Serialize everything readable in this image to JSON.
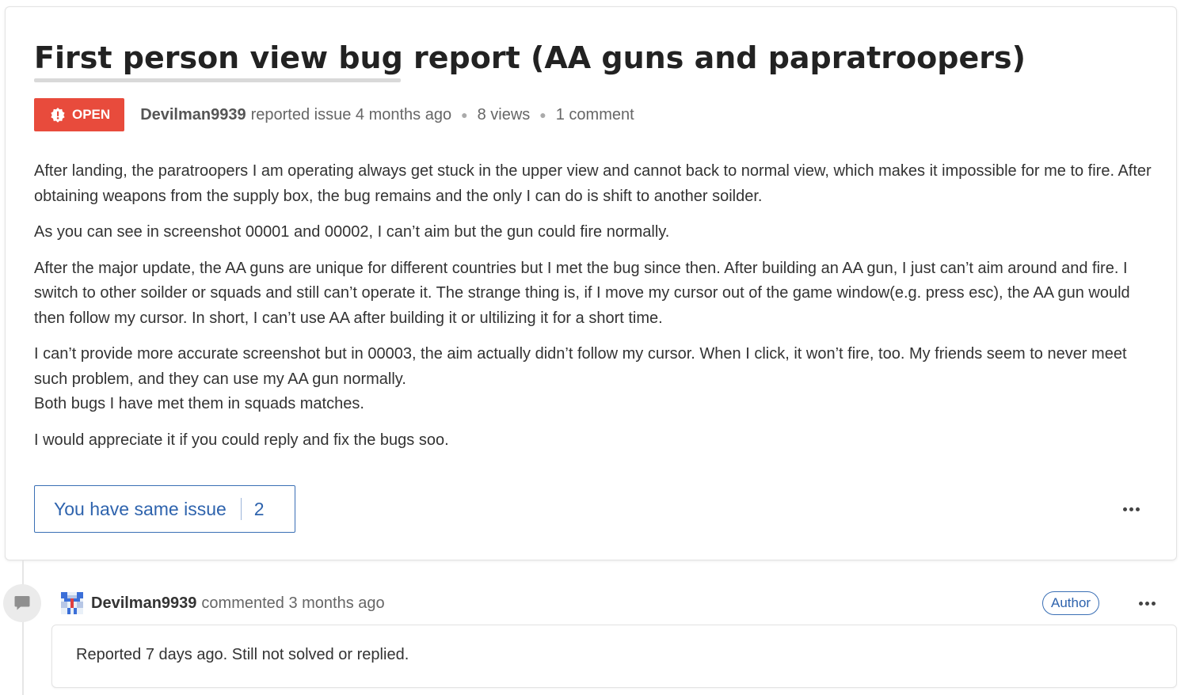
{
  "issue": {
    "title": "First person view bug report (AA guns and papratroopers)",
    "status": "OPEN",
    "author": "Devilman9939",
    "action": "reported issue 4 months ago",
    "views": "8 views",
    "comments": "1 comment",
    "paragraphs": [
      "After landing, the paratroopers I am operating always get stuck in the upper view and cannot back to normal view, which makes it impossible for me to fire. After obtaining weapons from the supply box, the bug remains and the only I can do is shift to another soilder.",
      "As you can see in screenshot 00001 and 00002, I can’t aim but the gun could fire normally.",
      "After the major update, the AA guns are unique for different countries but I met the bug since then. After building an AA gun, I just can’t aim around and fire. I switch to other soilder or squads and still can’t operate it. The strange thing is, if I move my cursor out of the game window(e.g. press esc), the AA gun would then follow my cursor. In short, I can’t use AA after building it or ultilizing it for a short time.",
      "I can’t provide more accurate screenshot but in 00003, the aim actually didn’t follow my cursor. When I click, it won’t fire, too. My friends seem to never meet such problem, and they can use my AA gun normally.",
      "Both bugs I have met them in squads matches.",
      "I would appreciate it if you could reply and fix the bugs soo."
    ],
    "same_issue_label": "You have same issue",
    "same_issue_count": "2"
  },
  "comment": {
    "author": "Devilman9939",
    "action": "commented 3 months ago",
    "badge": "Author",
    "text": "Reported 7 days ago. Still not solved or replied."
  },
  "colors": {
    "open_badge": "#e84b3c",
    "link_blue": "#2e63ad"
  },
  "icons": {
    "status": "alert-icon",
    "more": "more-horizontal-icon",
    "comment": "comment-bubble-icon",
    "avatar": "pixel-avatar"
  }
}
